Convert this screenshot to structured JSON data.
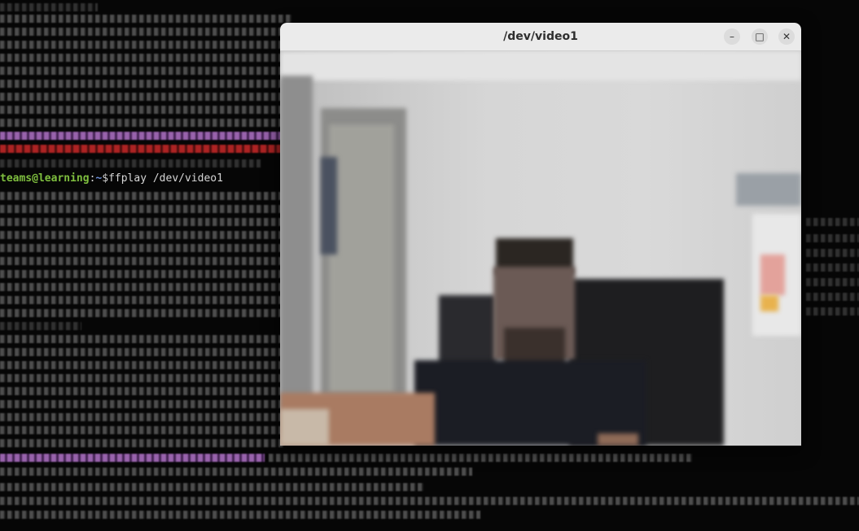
{
  "terminal": {
    "prompt_user": "teams@learning",
    "prompt_sep": ":",
    "prompt_path": "~",
    "prompt_symbol": "$",
    "prompt_command": "ffplay /dev/video1"
  },
  "window": {
    "title": "/dev/video1",
    "buttons": {
      "minimize": "–",
      "maximize": "□",
      "close": "✕"
    }
  },
  "colors": {
    "prompt_user": "#7fbf3f",
    "prompt_path": "#6c8fd8",
    "highlight_purple": "#ba78d2",
    "highlight_red": "#c82828",
    "titlebar": "#ebebeb"
  },
  "icons": {
    "minimize": "minimize-icon",
    "maximize": "maximize-icon",
    "close": "close-icon"
  }
}
